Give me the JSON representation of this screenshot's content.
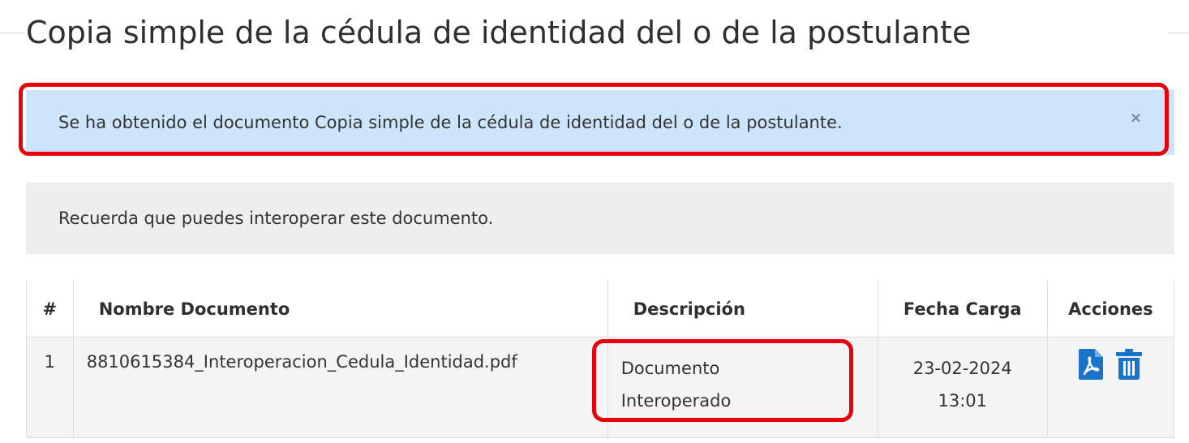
{
  "page": {
    "title": "Copia simple de la cédula de identidad del o de la postulante"
  },
  "alert": {
    "message": "Se ha obtenido el documento Copia simple de la cédula de identidad del o de la postulante.",
    "close_label": "×"
  },
  "notice": {
    "message": "Recuerda que puedes interoperar este documento."
  },
  "table": {
    "headers": {
      "num": "#",
      "name": "Nombre Documento",
      "description": "Descripción",
      "date": "Fecha Carga",
      "actions": "Acciones"
    },
    "rows": [
      {
        "num": "1",
        "name": "8810615384_Interoperacion_Cedula_Identidad.pdf",
        "description_line1": "Documento",
        "description_line2": "Interoperado",
        "date": "23-02-2024",
        "time": "13:01",
        "actions": [
          "pdf-icon",
          "trash-icon"
        ]
      }
    ]
  },
  "colors": {
    "alert_bg": "#cce5fb",
    "notice_bg": "#eeeeee",
    "highlight": "#e8000b",
    "icon_blue": "#1a73c8"
  }
}
